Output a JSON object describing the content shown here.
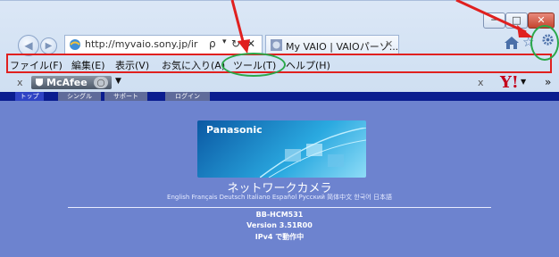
{
  "browser": {
    "window_controls": {
      "minimize_glyph": "─",
      "maximize_glyph": "□",
      "close_glyph": "✕"
    },
    "address": {
      "url": "http://myvaio.sony.jp/ir",
      "search_glyph": "ρ",
      "dropdown_glyph": "▾",
      "refresh_glyph": "↻",
      "stop_glyph": "✕"
    },
    "tab": {
      "title": "My VAIO | VAIOパーソ...",
      "close_glyph": "✕"
    },
    "toolbar_icons": [
      "home-icon",
      "favorites-star-icon",
      "tools-gear-icon"
    ],
    "menu": [
      {
        "label": "ファイル(F)"
      },
      {
        "label": "編集(E)"
      },
      {
        "label": "表示(V)"
      },
      {
        "label": "お気に入り(A)"
      },
      {
        "label": "ツール(T)"
      },
      {
        "label": "ヘルプ(H)"
      }
    ],
    "addon_bar": {
      "close_left": "x",
      "mcafee_label": "McAfee",
      "mcafee_dropdown": "◯",
      "menu_arrow": "▼",
      "close_right": "x",
      "yahoo_label": "Y!",
      "yahoo_dropdown": "▼",
      "overflow": "»"
    }
  },
  "annotations": {
    "arrow_color": "#e0201f",
    "box_color": "#e0201f",
    "circle_color": "#2aa84a"
  },
  "camera_page": {
    "nav_tabs": [
      {
        "label": "トップ"
      },
      {
        "label": "シングル"
      },
      {
        "label": "サポート"
      },
      {
        "label": "ログイン"
      }
    ],
    "brand": "Panasonic",
    "title": "ネットワークカメラ",
    "languages": "English  Français  Deutsch  Italiano  Español  Русский  简体中文  한국어  日本語",
    "model": "BB-HCM531",
    "version": "Version 3.51R00",
    "ip_status": "IPv4 で動作中"
  }
}
